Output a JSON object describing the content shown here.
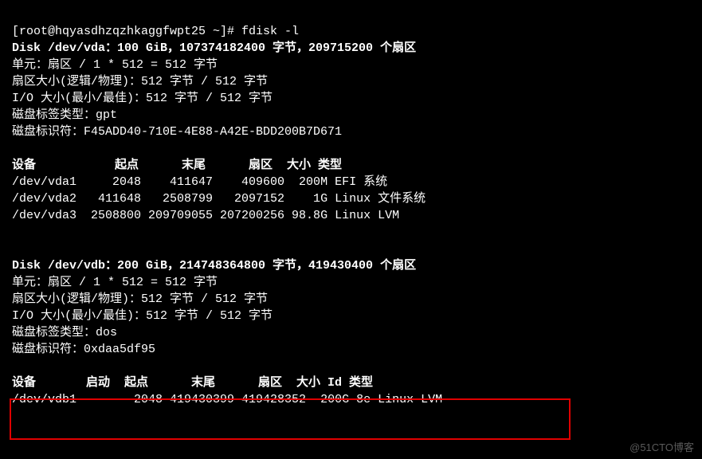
{
  "prompt": "[root@hqyasdhzqzhkaggfwpt25 ~]# ",
  "command": "fdisk -l",
  "disk1": {
    "header": "Disk /dev/vda：100 GiB，107374182400 字节，209715200 个扇区",
    "unit": "单元：扇区 / 1 * 512 = 512 字节",
    "sector": "扇区大小(逻辑/物理)：512 字节 / 512 字节",
    "io": "I/O 大小(最小/最佳)：512 字节 / 512 字节",
    "labeltype": "磁盘标签类型：gpt",
    "identifier": "磁盘标识符：F45ADD40-710E-4E88-A42E-BDD200B7D671"
  },
  "table1": {
    "header": "设备           起点      末尾      扇区  大小 类型",
    "row1": "/dev/vda1     2048    411647    409600  200M EFI 系统",
    "row2": "/dev/vda2   411648   2508799   2097152    1G Linux 文件系统",
    "row3": "/dev/vda3  2508800 209709055 207200256 98.8G Linux LVM"
  },
  "disk2": {
    "header": "Disk /dev/vdb：200 GiB，214748364800 字节，419430400 个扇区",
    "unit": "单元：扇区 / 1 * 512 = 512 字节",
    "sector": "扇区大小(逻辑/物理)：512 字节 / 512 字节",
    "io": "I/O 大小(最小/最佳)：512 字节 / 512 字节",
    "labeltype": "磁盘标签类型：dos",
    "identifier": "磁盘标识符：0xdaa5df95"
  },
  "table2": {
    "header": "设备       启动  起点      末尾      扇区  大小 Id 类型",
    "row1": "/dev/vdb1        2048 419430399 419428352  200G 8e Linux LVM"
  },
  "watermark": "@51CTO博客"
}
